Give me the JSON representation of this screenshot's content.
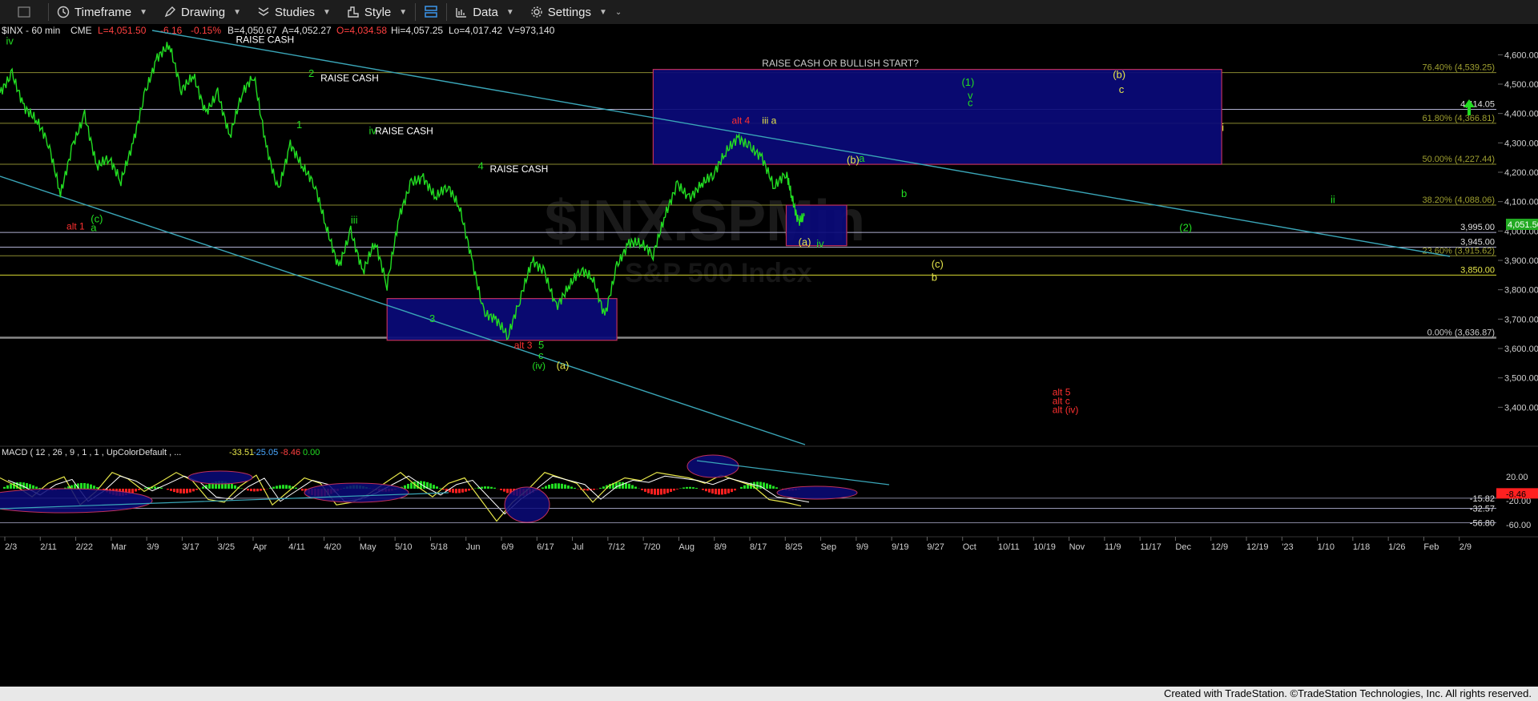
{
  "toolbar": {
    "items": [
      {
        "label": "Timeframe",
        "icon": "clock-icon"
      },
      {
        "label": "Drawing",
        "icon": "pencil-icon"
      },
      {
        "label": "Studies",
        "icon": "studies-icon"
      },
      {
        "label": "Style",
        "icon": "style-icon"
      },
      {
        "label": "Data",
        "icon": "data-icon"
      },
      {
        "label": "Settings",
        "icon": "gear-icon"
      }
    ]
  },
  "header": {
    "symbol": "$INX - 60 min",
    "exchange": "CME",
    "last": "L=4,051.50",
    "change": "-6.16",
    "change_pct": "-0.15%",
    "bid": "B=4,050.67",
    "ask": "A=4,052.27",
    "open": "O=4,034.58",
    "high": "Hi=4,057.25",
    "low": "Lo=4,017.42",
    "volume": "V=973,140"
  },
  "watermark": {
    "line1": "$INX.SPMin",
    "line2": "S&P 500 Index"
  },
  "macd_header": {
    "label": "MACD ( 12 , 26 , 9 , 1 , 1 , UpColorDefault , ...",
    "v1": "-33.51",
    "v2": "-25.05",
    "v3": "-8.46",
    "v4": "0.00"
  },
  "footer": "Created with TradeStation. ©TradeStation Technologies, Inc. All rights reserved.",
  "colors": {
    "price": "#22dd22",
    "box": "#0a0a7a",
    "box_border": "#c0305a",
    "trend": "#3aa6b8",
    "fib": "#8a8a30",
    "level": "#b0b0d0"
  },
  "chart_data": {
    "type": "line",
    "title": "$INX - 60 min",
    "ylim": [
      3300,
      4650
    ],
    "y_ticks": [
      "4,600.00",
      "4,500.00",
      "4,400.00",
      "4,300.00",
      "4,200.00",
      "4,100.00",
      "4,000.00",
      "3,900.00",
      "3,800.00",
      "3,700.00",
      "3,600.00",
      "3,500.00",
      "3,400.00"
    ],
    "x_ticks": [
      "2/3",
      "2/11",
      "2/22",
      "Mar",
      "3/9",
      "3/17",
      "3/25",
      "Apr",
      "4/11",
      "4/20",
      "May",
      "5/10",
      "5/18",
      "Jun",
      "6/9",
      "6/17",
      "Jul",
      "7/12",
      "7/20",
      "Aug",
      "8/9",
      "8/17",
      "8/25",
      "Sep",
      "9/9",
      "9/19",
      "9/27",
      "Oct",
      "10/11",
      "10/19",
      "Nov",
      "11/9",
      "11/17",
      "Dec",
      "12/9",
      "12/19",
      "'23",
      "1/10",
      "1/18",
      "1/26",
      "Feb",
      "2/9"
    ],
    "last_price_label": "4,051.50",
    "price_path": [
      [
        0,
        4470
      ],
      [
        2,
        4535
      ],
      [
        4,
        4420
      ],
      [
        6,
        4380
      ],
      [
        8,
        4300
      ],
      [
        10,
        4125
      ],
      [
        12,
        4290
      ],
      [
        14,
        4395
      ],
      [
        16,
        4220
      ],
      [
        18,
        4250
      ],
      [
        20,
        4170
      ],
      [
        22,
        4300
      ],
      [
        24,
        4470
      ],
      [
        26,
        4590
      ],
      [
        28,
        4635
      ],
      [
        30,
        4480
      ],
      [
        32,
        4530
      ],
      [
        34,
        4400
      ],
      [
        36,
        4470
      ],
      [
        38,
        4320
      ],
      [
        40,
        4470
      ],
      [
        42,
        4530
      ],
      [
        44,
        4290
      ],
      [
        46,
        4135
      ],
      [
        48,
        4295
      ],
      [
        50,
        4220
      ],
      [
        52,
        4160
      ],
      [
        54,
        4010
      ],
      [
        56,
        3875
      ],
      [
        58,
        4000
      ],
      [
        60,
        3860
      ],
      [
        62,
        3965
      ],
      [
        64,
        3815
      ],
      [
        66,
        4050
      ],
      [
        68,
        4165
      ],
      [
        70,
        4180
      ],
      [
        72,
        4115
      ],
      [
        74,
        4155
      ],
      [
        76,
        4080
      ],
      [
        78,
        3905
      ],
      [
        80,
        3720
      ],
      [
        82,
        3700
      ],
      [
        84,
        3642
      ],
      [
        86,
        3770
      ],
      [
        88,
        3900
      ],
      [
        90,
        3860
      ],
      [
        92,
        3740
      ],
      [
        94,
        3810
      ],
      [
        96,
        3870
      ],
      [
        98,
        3840
      ],
      [
        100,
        3710
      ],
      [
        102,
        3880
      ],
      [
        104,
        3960
      ],
      [
        106,
        3960
      ],
      [
        108,
        3920
      ],
      [
        110,
        4055
      ],
      [
        112,
        4160
      ],
      [
        114,
        4110
      ],
      [
        116,
        4160
      ],
      [
        118,
        4195
      ],
      [
        120,
        4270
      ],
      [
        122,
        4318
      ],
      [
        124,
        4285
      ],
      [
        126,
        4250
      ],
      [
        128,
        4150
      ],
      [
        130,
        4200
      ],
      [
        131,
        4110
      ],
      [
        132,
        4030
      ],
      [
        133,
        4051
      ]
    ],
    "horizontal_levels": [
      {
        "label": "76.40% (4,539.25)",
        "value": 4539.25,
        "kind": "fib"
      },
      {
        "label": "4,414.05",
        "value": 4414.05,
        "kind": "level"
      },
      {
        "label": "61.80% (4,366.81)",
        "value": 4366.81,
        "kind": "fib"
      },
      {
        "label": "50.00% (4,227.44)",
        "value": 4227.44,
        "kind": "fib"
      },
      {
        "label": "38.20% (4,088.06)",
        "value": 4088.06,
        "kind": "fib"
      },
      {
        "label": "3,995.00",
        "value": 3995,
        "kind": "level"
      },
      {
        "label": "3,945.00",
        "value": 3945,
        "kind": "level"
      },
      {
        "label": "23.60% (3,915.62)",
        "value": 3915.62,
        "kind": "fib"
      },
      {
        "label": "3,850.00",
        "value": 3850,
        "kind": "yellow"
      },
      {
        "label": "0.00% (3,636.87)",
        "value": 3636.87,
        "kind": "fib0"
      }
    ],
    "boxes": [
      {
        "name": "upper-target-box",
        "x0": 108,
        "x1": 202,
        "y0": 4227,
        "y1": 4550
      },
      {
        "name": "support-box",
        "x0": 130,
        "x1": 140,
        "y0": 3950,
        "y1": 4088
      },
      {
        "name": "bottom-box",
        "x0": 64,
        "x1": 102,
        "y0": 3628,
        "y1": 3770
      }
    ],
    "annotations": [
      {
        "text": "RAISE CASH",
        "x": 39,
        "y": 4640,
        "color": "#ffffff"
      },
      {
        "text": "RAISE CASH",
        "x": 53,
        "y": 4510,
        "color": "#ffffff"
      },
      {
        "text": "RAISE CASH",
        "x": 62,
        "y": 4330,
        "color": "#ffffff"
      },
      {
        "text": "RAISE CASH",
        "x": 81,
        "y": 4200,
        "color": "#ffffff"
      },
      {
        "text": "RAISE CASH OR BULLISH START?",
        "x": 126,
        "y": 4560,
        "color": "#cccccc"
      },
      {
        "text": "(1)",
        "x": 159,
        "y": 4495,
        "color": "#22dd22"
      },
      {
        "text": "(b)",
        "x": 184,
        "y": 4520,
        "color": "#e6e64a"
      },
      {
        "text": "c",
        "x": 185,
        "y": 4470,
        "color": "#e6e64a"
      },
      {
        "text": "(2)",
        "x": 195,
        "y": 4000,
        "color": "#22dd22"
      },
      {
        "text": "alt 4",
        "x": 121,
        "y": 4365,
        "color": "#ff3030"
      },
      {
        "text": "iii a",
        "x": 126,
        "y": 4365,
        "color": "#e6e64a"
      },
      {
        "text": "(iv)",
        "x": 88,
        "y": 3530,
        "color": "#22dd22"
      },
      {
        "text": "(a)",
        "x": 92,
        "y": 3530,
        "color": "#e6e64a"
      },
      {
        "text": "c",
        "x": 89,
        "y": 3565,
        "color": "#22dd22"
      },
      {
        "text": "5",
        "x": 89,
        "y": 3600,
        "color": "#22dd22"
      },
      {
        "text": "alt 3",
        "x": 85,
        "y": 3600,
        "color": "#ff3030"
      },
      {
        "text": "alt 5",
        "x": 174,
        "y": 3440,
        "color": "#ff3030"
      },
      {
        "text": "alt c",
        "x": 174,
        "y": 3410,
        "color": "#ff3030"
      },
      {
        "text": "alt (iv)",
        "x": 174,
        "y": 3380,
        "color": "#ff3030"
      },
      {
        "text": "alt 1",
        "x": 11,
        "y": 4005,
        "color": "#ff3030"
      },
      {
        "text": "a",
        "x": 15,
        "y": 4000,
        "color": "#22dd22"
      },
      {
        "text": "(c)",
        "x": 15,
        "y": 4030,
        "color": "#22dd22"
      },
      {
        "text": "iv",
        "x": 135,
        "y": 3945,
        "color": "#22dd22"
      },
      {
        "text": "(a)",
        "x": 132,
        "y": 3950,
        "color": "#e6e64a"
      },
      {
        "text": "(b)",
        "x": 140,
        "y": 4230,
        "color": "#e6e64a"
      },
      {
        "text": "a",
        "x": 142,
        "y": 4235,
        "color": "#22dd22"
      },
      {
        "text": "b",
        "x": 149,
        "y": 4115,
        "color": "#22dd22"
      },
      {
        "text": "(c)",
        "x": 154,
        "y": 3875,
        "color": "#e6e64a"
      },
      {
        "text": "b",
        "x": 154,
        "y": 3830,
        "color": "#e6e64a"
      },
      {
        "text": "i",
        "x": 202,
        "y": 4340,
        "color": "#e6e64a"
      },
      {
        "text": "ii",
        "x": 220,
        "y": 4095,
        "color": "#22dd22"
      },
      {
        "text": "v",
        "x": 160,
        "y": 4450,
        "color": "#22dd22"
      },
      {
        "text": "c",
        "x": 160,
        "y": 4425,
        "color": "#22dd22"
      },
      {
        "text": "iv",
        "x": 1,
        "y": 4635,
        "color": "#22dd22"
      },
      {
        "text": "2",
        "x": 51,
        "y": 4525,
        "color": "#22dd22"
      },
      {
        "text": "1",
        "x": 49,
        "y": 4350,
        "color": "#22dd22"
      },
      {
        "text": "iv",
        "x": 61,
        "y": 4330,
        "color": "#22dd22"
      },
      {
        "text": "4",
        "x": 79,
        "y": 4210,
        "color": "#22dd22"
      },
      {
        "text": "3",
        "x": 71,
        "y": 3690,
        "color": "#22dd22"
      },
      {
        "text": "iii",
        "x": 58,
        "y": 4025,
        "color": "#22dd22"
      }
    ]
  },
  "macd_data": {
    "axis_labels": [
      "20.00",
      "-20.00",
      "-60.00"
    ],
    "value_labels": [
      "-15.82",
      "-8.46",
      "-32.57",
      "-56.80"
    ],
    "macd_line": [
      20,
      5,
      -15,
      10,
      22,
      -30,
      -5,
      30,
      18,
      -5,
      12,
      30,
      15,
      -20,
      -25,
      5,
      25,
      -30,
      -5,
      20,
      10,
      -30,
      -25,
      -10,
      10,
      30,
      5,
      -15,
      10,
      20,
      -20,
      -60,
      -25,
      0,
      30,
      20,
      10,
      -25,
      5,
      20,
      15,
      30,
      25,
      20,
      10,
      25,
      15,
      5,
      -20,
      -25,
      -32
    ]
  }
}
